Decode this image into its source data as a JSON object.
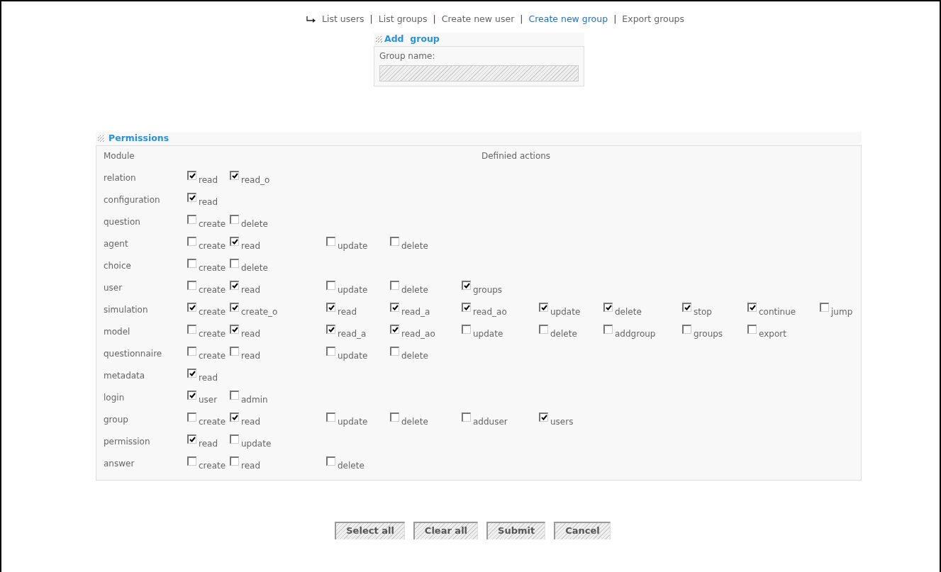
{
  "nav": {
    "links": [
      {
        "text": "List users",
        "selected": false
      },
      {
        "text": "List groups",
        "selected": false
      },
      {
        "text": "Create new user",
        "selected": false
      },
      {
        "text": "Create new group",
        "selected": true
      },
      {
        "text": "Export groups",
        "selected": false
      }
    ],
    "separators": [
      "|",
      "|",
      "|",
      "|"
    ]
  },
  "add_group": {
    "title": "Add  group",
    "field_label": "Group name:"
  },
  "permissions": {
    "title": "Permissions",
    "module_header": "Module",
    "actions_header": "Definied actions",
    "rows": [
      {
        "module": "relation",
        "actions": [
          {
            "label": "read",
            "checked": true
          },
          {
            "label": "read_o",
            "checked": true
          }
        ]
      },
      {
        "module": "configuration",
        "actions": [
          {
            "label": "read",
            "checked": true
          }
        ]
      },
      {
        "module": "question",
        "actions": [
          {
            "label": "create",
            "checked": false
          },
          {
            "label": "delete",
            "checked": false
          }
        ]
      },
      {
        "module": "agent",
        "actions": [
          {
            "label": "create",
            "checked": false
          },
          {
            "label": "read",
            "checked": true
          },
          {
            "label": "update",
            "checked": false
          },
          {
            "label": "delete",
            "checked": false
          }
        ]
      },
      {
        "module": "choice",
        "actions": [
          {
            "label": "create",
            "checked": false
          },
          {
            "label": "delete",
            "checked": false
          }
        ]
      },
      {
        "module": "user",
        "actions": [
          {
            "label": "create",
            "checked": false
          },
          {
            "label": "read",
            "checked": true
          },
          {
            "label": "update",
            "checked": false
          },
          {
            "label": "delete",
            "checked": false
          },
          {
            "label": "groups",
            "checked": true
          }
        ]
      },
      {
        "module": "simulation",
        "actions": [
          {
            "label": "create",
            "checked": true
          },
          {
            "label": "create_o",
            "checked": true
          },
          {
            "label": "read",
            "checked": true
          },
          {
            "label": "read_a",
            "checked": true
          },
          {
            "label": "read_ao",
            "checked": true
          },
          {
            "label": "update",
            "checked": true
          },
          {
            "label": "delete",
            "checked": true
          },
          {
            "label": "stop",
            "checked": true
          },
          {
            "label": "continue",
            "checked": true
          },
          {
            "label": "jump",
            "checked": false
          }
        ]
      },
      {
        "module": "model",
        "actions": [
          {
            "label": "create",
            "checked": false
          },
          {
            "label": "read",
            "checked": true
          },
          {
            "label": "read_a",
            "checked": true
          },
          {
            "label": "read_ao",
            "checked": true
          },
          {
            "label": "update",
            "checked": false
          },
          {
            "label": "delete",
            "checked": false
          },
          {
            "label": "addgroup",
            "checked": false
          },
          {
            "label": "groups",
            "checked": false
          },
          {
            "label": "export",
            "checked": false
          }
        ]
      },
      {
        "module": "questionnaire",
        "actions": [
          {
            "label": "create",
            "checked": false
          },
          {
            "label": "read",
            "checked": false
          },
          {
            "label": "update",
            "checked": false
          },
          {
            "label": "delete",
            "checked": false
          }
        ]
      },
      {
        "module": "metadata",
        "actions": [
          {
            "label": "read",
            "checked": true
          }
        ]
      },
      {
        "module": "login",
        "actions": [
          {
            "label": "user",
            "checked": true
          },
          {
            "label": "admin",
            "checked": false
          }
        ]
      },
      {
        "module": "group",
        "actions": [
          {
            "label": "create",
            "checked": false
          },
          {
            "label": "read",
            "checked": true
          },
          {
            "label": "update",
            "checked": false
          },
          {
            "label": "delete",
            "checked": false
          },
          {
            "label": "adduser",
            "checked": false
          },
          {
            "label": "users",
            "checked": true
          }
        ]
      },
      {
        "module": "permission",
        "actions": [
          {
            "label": "read",
            "checked": true
          },
          {
            "label": "update",
            "checked": false
          }
        ]
      },
      {
        "module": "answer",
        "actions": [
          {
            "label": "create",
            "checked": false
          },
          {
            "label": "read",
            "checked": false
          },
          {
            "label": "delete",
            "checked": false
          }
        ]
      }
    ]
  },
  "buttons": [
    "Select all",
    "Clear all",
    "Submit",
    "Cancel"
  ]
}
